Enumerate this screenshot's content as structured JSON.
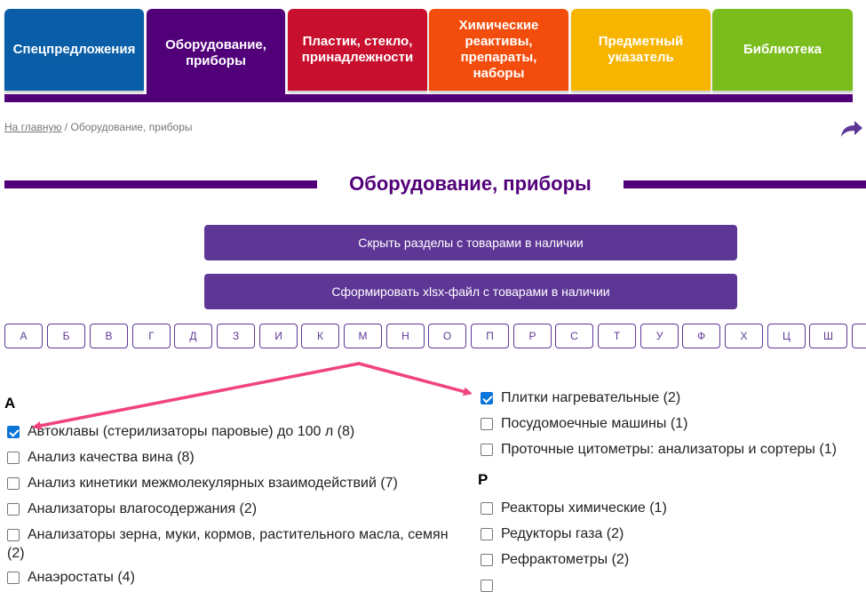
{
  "tabs": [
    {
      "label": "Спецпредложения",
      "color": "#0a5ea8"
    },
    {
      "label": "Оборудование,\nприборы",
      "color": "#52007a"
    },
    {
      "label": "Пластик, стекло,\nпринадлежности",
      "color": "#c8102e"
    },
    {
      "label": "Химические\nреактивы,\nпрепараты,\nнаборы",
      "color": "#f24d0c"
    },
    {
      "label": "Предметный\nуказатель",
      "color": "#f7b500"
    },
    {
      "label": "Библиотека",
      "color": "#7cbd1e"
    }
  ],
  "breadcrumb": {
    "home": "На главную",
    "separator": " / ",
    "current": "Оборудование, приборы"
  },
  "page_title": "Оборудование, приборы",
  "actions": {
    "hide_sections": "Скрыть разделы с товарами в наличии",
    "make_xlsx": "Сформировать xlsx-файл с товарами в наличии"
  },
  "alphabet": [
    "А",
    "Б",
    "В",
    "Г",
    "Д",
    "З",
    "И",
    "К",
    "М",
    "Н",
    "О",
    "П",
    "Р",
    "С",
    "Т",
    "У",
    "Ф",
    "Х",
    "Ц",
    "Ш"
  ],
  "left_column": {
    "letter": "А",
    "items": [
      {
        "text": "Автоклавы (стерилизаторы паровые) до 100 л (8)",
        "checked": true
      },
      {
        "text": "Анализ качества вина (8)",
        "checked": false
      },
      {
        "text": "Анализ кинетики межмолекулярных взаимодействий (7)",
        "checked": false
      },
      {
        "text": "Анализаторы влагосодержания (2)",
        "checked": false
      },
      {
        "text": "Анализаторы зерна, муки, кормов, растительного масла, семян",
        "text2": "(2)",
        "checked": false
      },
      {
        "text": "Анаэростаты (4)",
        "checked": false
      }
    ]
  },
  "right_column": {
    "items_top": [
      {
        "text": "Плитки нагревательные (2)",
        "checked": true
      },
      {
        "text": "Посудомоечные машины (1)",
        "checked": false
      },
      {
        "text": "Проточные цитометры: анализаторы и сортеры (1)",
        "checked": false
      }
    ],
    "letter": "Р",
    "items_bottom": [
      {
        "text": "Реакторы химические (1)",
        "checked": false
      },
      {
        "text": "Редукторы газа (2)",
        "checked": false
      },
      {
        "text": "Рефрактометры (2)",
        "checked": false
      },
      {
        "text": "",
        "checked": false
      }
    ]
  },
  "colors": {
    "accent": "#52007a",
    "button": "#5e3796",
    "annotation_arrow": "#f0437f"
  }
}
